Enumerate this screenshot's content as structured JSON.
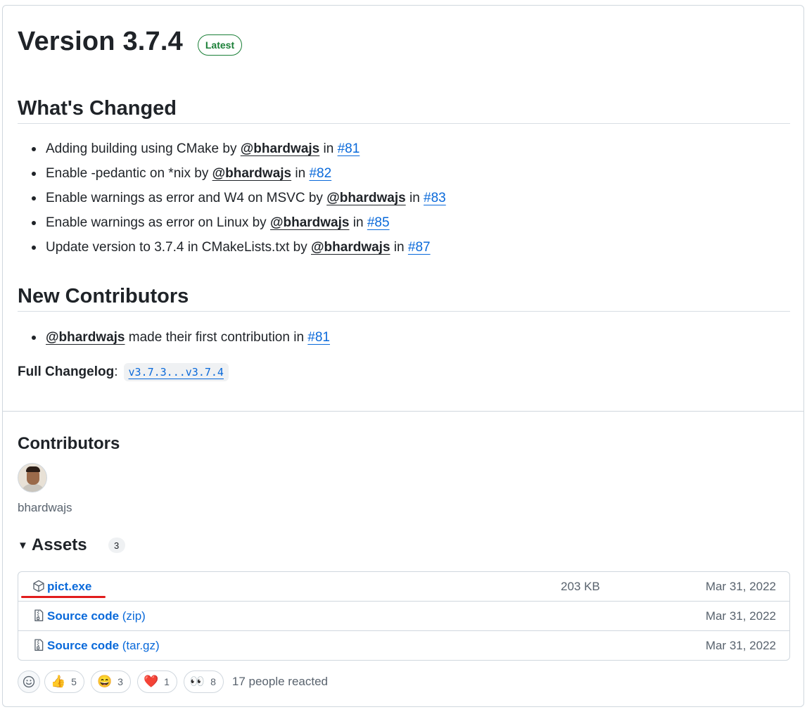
{
  "release": {
    "title": "Version 3.7.4",
    "badge": "Latest"
  },
  "whats_changed": {
    "heading": "What's Changed",
    "items": [
      {
        "text": "Adding building using CMake by ",
        "author": "@bhardwajs",
        "in": " in ",
        "pr": "#81"
      },
      {
        "text": "Enable -pedantic on *nix by ",
        "author": "@bhardwajs",
        "in": " in ",
        "pr": "#82"
      },
      {
        "text": "Enable warnings as error and W4 on MSVC by ",
        "author": "@bhardwajs",
        "in": " in ",
        "pr": "#83"
      },
      {
        "text": "Enable warnings as error on Linux by ",
        "author": "@bhardwajs",
        "in": " in ",
        "pr": "#85"
      },
      {
        "text": "Update version to 3.7.4 in CMakeLists.txt by ",
        "author": "@bhardwajs",
        "in": " in ",
        "pr": "#87"
      }
    ]
  },
  "new_contributors": {
    "heading": "New Contributors",
    "items": [
      {
        "author": "@bhardwajs",
        "text": " made their first contribution in ",
        "pr": "#81"
      }
    ]
  },
  "changelog": {
    "label": "Full Changelog",
    "colon": ":",
    "link": "v3.7.3...v3.7.4"
  },
  "contributors": {
    "heading": "Contributors",
    "name": "bhardwajs"
  },
  "assets": {
    "heading": "Assets",
    "count": "3",
    "rows": [
      {
        "name": "pict.exe",
        "ext": "",
        "size": "203 KB",
        "date": "Mar 31, 2022",
        "icon": "package-icon"
      },
      {
        "name": "Source code",
        "ext": " (zip)",
        "size": "",
        "date": "Mar 31, 2022",
        "icon": "file-zip-icon"
      },
      {
        "name": "Source code",
        "ext": " (tar.gz)",
        "size": "",
        "date": "Mar 31, 2022",
        "icon": "file-zip-icon"
      }
    ]
  },
  "reactions": {
    "items": [
      {
        "emoji": "👍",
        "count": "5",
        "icon": "thumbs-up-icon"
      },
      {
        "emoji": "😄",
        "count": "3",
        "icon": "laugh-icon"
      },
      {
        "emoji": "❤️",
        "count": "1",
        "icon": "heart-icon"
      },
      {
        "emoji": "👀",
        "count": "8",
        "icon": "eyes-icon"
      }
    ],
    "summary": "17 people reacted"
  },
  "colors": {
    "link": "#0969da",
    "badge_green": "#1a7f37",
    "annotation_red": "#e11d1d",
    "border": "#d0d7de",
    "muted_text": "#59636e"
  }
}
